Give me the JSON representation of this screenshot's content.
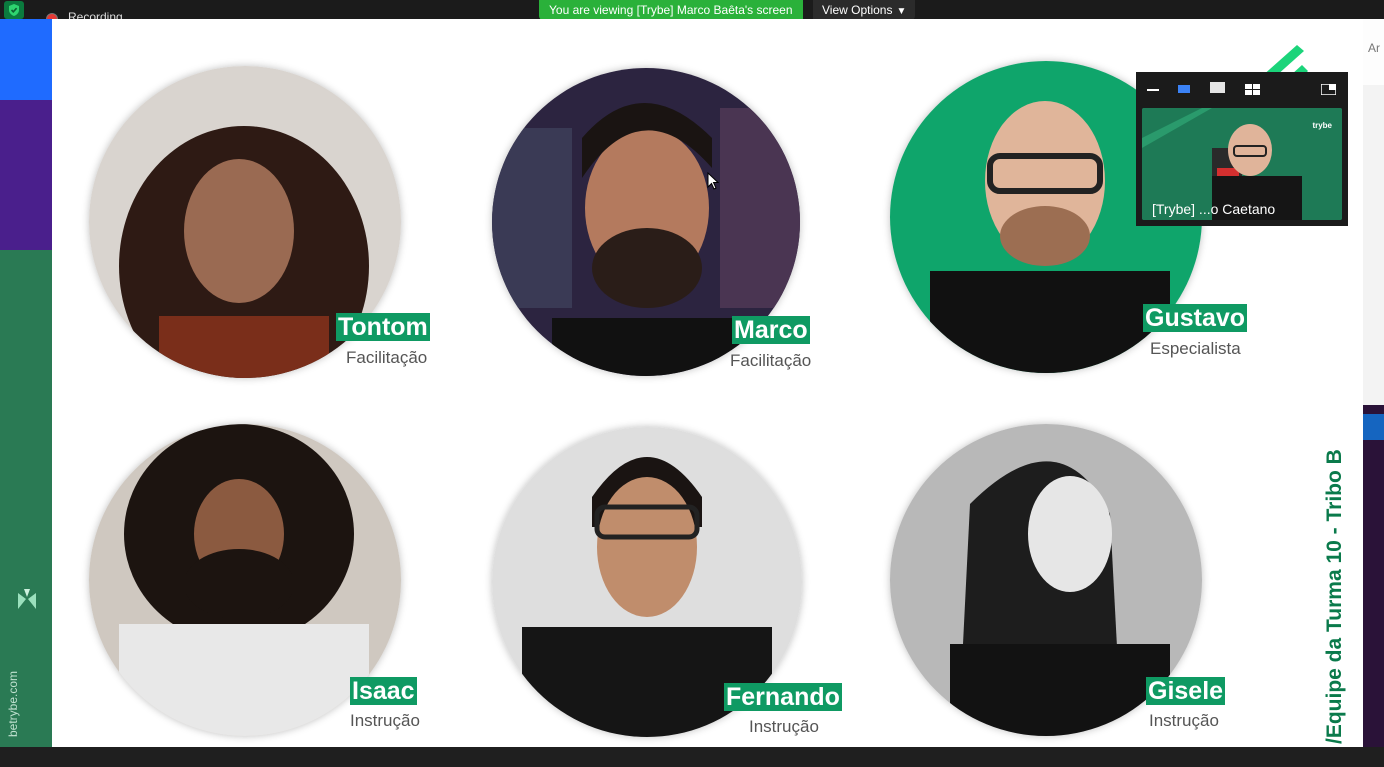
{
  "topbar": {
    "recording_label": "Recording",
    "viewing_banner": "You are viewing [Trybe] Marco Baêta's screen",
    "view_options_label": "View Options"
  },
  "left_strip": {
    "url_text": "betrybe.com"
  },
  "slide": {
    "vertical_title": "/Equipe da Turma 10 - Tribo B",
    "members": [
      {
        "name": "Tontom",
        "role": "Facilitação"
      },
      {
        "name": "Marco",
        "role": "Facilitação"
      },
      {
        "name": "Gustavo",
        "role": "Especialista"
      },
      {
        "name": "Isaac",
        "role": "Instrução"
      },
      {
        "name": "Fernando",
        "role": "Instrução"
      },
      {
        "name": "Gisele",
        "role": "Instrução"
      }
    ]
  },
  "thumbnail": {
    "participant_name": "[Trybe] ...o Caetano",
    "brand_text": "trybe"
  },
  "right_panel": {
    "peek_text": "Ar"
  },
  "colors": {
    "brand_green": "#0f9a63",
    "banner_green": "#2ab13a",
    "title_green": "#0a7a4b"
  }
}
